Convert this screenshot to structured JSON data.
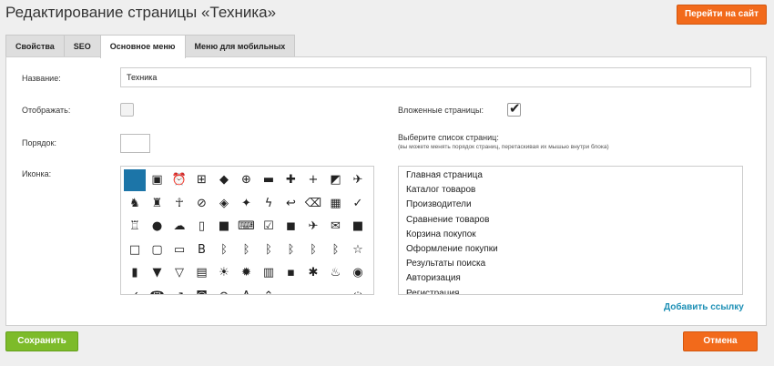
{
  "header": {
    "title": "Редактирование страницы «Техника»",
    "goto_site_label": "Перейти на сайт"
  },
  "tabs": [
    {
      "label": "Свойства"
    },
    {
      "label": "SEO"
    },
    {
      "label": "Основное меню"
    },
    {
      "label": "Меню для мобильных"
    }
  ],
  "form": {
    "name_label": "Название:",
    "name_value": "Техника",
    "display_label": "Отображать:",
    "display_checked": false,
    "nested_label": "Вложенные страницы:",
    "nested_checked": true,
    "nested_check_glyph": "✔",
    "order_label": "Порядок:",
    "order_value": "",
    "icon_label": "Иконка:",
    "pages_label": "Выберите список страниц:",
    "pages_hint": "(вы можете менять порядок страниц, перетаскивая их мышью внутри блока)"
  },
  "icon_rows": [
    [
      "selected-square",
      "contact-card",
      "alarm",
      "add-box",
      "label",
      "add-circle",
      "comment",
      "person-add",
      "plus",
      "exposure",
      "airplane"
    ],
    [
      "android",
      "android-robot",
      "accessibility",
      "attachment",
      "auto-wb",
      "auto-fix",
      "flash-auto",
      "reply",
      "backspace",
      "view-quilt",
      "verified"
    ],
    [
      "robot",
      "mouse",
      "cloud",
      "phone-android",
      "videocam",
      "keyboard",
      "check-box",
      "chat-bubble",
      "flight",
      "email",
      "stop"
    ],
    [
      "square-outline",
      "crop-square",
      "tablet",
      "bold-b",
      "bluetooth",
      "bluetooth-disabled",
      "bluetooth-audio",
      "bluetooth-connected",
      "bluetooth-searching",
      "bluetooth-off",
      "star-outline"
    ],
    [
      "book",
      "bookmark",
      "bookmark-outline",
      "work",
      "lightbulb",
      "brightness",
      "view-week",
      "message",
      "bug",
      "whatshot",
      "camera"
    ],
    [
      "check",
      "phone-forward",
      "call-made",
      "photo-camera",
      "cancel",
      "text-format",
      "expand-less",
      "car",
      "directions-car",
      "train",
      "spinner"
    ]
  ],
  "icon_glyphs": {
    "selected-square": "",
    "contact-card": "▣",
    "alarm": "⏰",
    "add-box": "⊞",
    "label": "◆",
    "add-circle": "⊕",
    "comment": "▬",
    "person-add": "✚",
    "plus": "+",
    "exposure": "◩",
    "airplane": "✈",
    "android": "♞",
    "android-robot": "♜",
    "accessibility": "☥",
    "attachment": "⊘",
    "auto-wb": "◈",
    "auto-fix": "✦",
    "flash-auto": "ϟ",
    "reply": "↩",
    "backspace": "⌫",
    "view-quilt": "▦",
    "verified": "✓",
    "robot": "♖",
    "mouse": "●",
    "cloud": "☁",
    "phone-android": "▯",
    "videocam": "■",
    "keyboard": "⌨",
    "check-box": "☑",
    "chat-bubble": "◼",
    "flight": "✈",
    "email": "✉",
    "stop": "■",
    "square-outline": "□",
    "crop-square": "▢",
    "tablet": "▭",
    "bold-b": "B",
    "bluetooth": "ᛒ",
    "bluetooth-disabled": "ᛒ",
    "bluetooth-audio": "ᛒ",
    "bluetooth-connected": "ᛒ",
    "bluetooth-searching": "ᛒ",
    "bluetooth-off": "ᛒ",
    "star-outline": "☆",
    "book": "▮",
    "bookmark": "▼",
    "bookmark-outline": "▽",
    "work": "▤",
    "lightbulb": "☀",
    "brightness": "✹",
    "view-week": "▥",
    "message": "▪",
    "bug": "✱",
    "whatshot": "♨",
    "camera": "◉",
    "check": "✓",
    "phone-forward": "☎",
    "call-made": "↗",
    "photo-camera": "◙",
    "cancel": "⊗",
    "text-format": "A",
    "expand-less": "⌃",
    "car": "▭",
    "directions-car": "▭",
    "train": "▭",
    "spinner": "◌"
  },
  "pages": [
    "Главная страница",
    "Каталог товаров",
    "Производители",
    "Сравнение товаров",
    "Корзина покупок",
    "Оформление покупки",
    "Результаты поиска",
    "Авторизация",
    "Регистрация"
  ],
  "add_link_label": "Добавить ссылку",
  "footer": {
    "save_label": "Сохранить",
    "cancel_label": "Отмена"
  },
  "colors": {
    "accent_orange": "#f26a1b",
    "save_green": "#7dbb2a",
    "link_blue": "#1c8fb5",
    "selected_icon_blue": "#1c75a8"
  }
}
